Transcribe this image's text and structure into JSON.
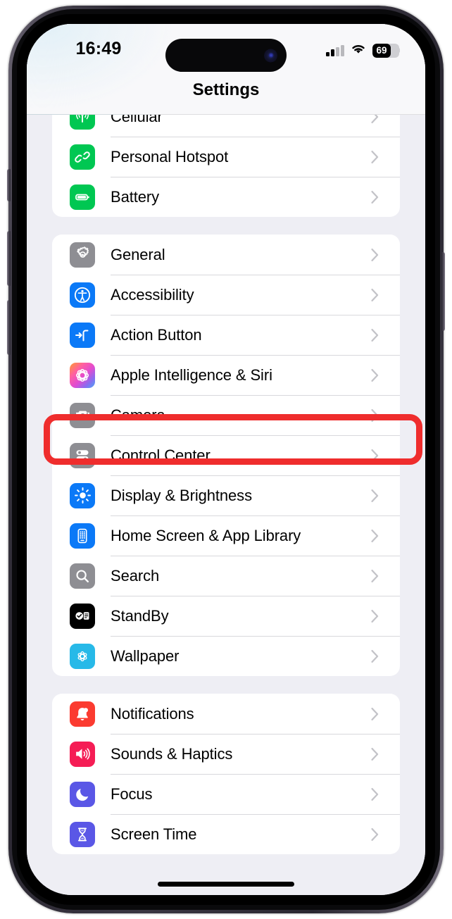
{
  "statusbar": {
    "time": "16:49",
    "battery_percent": "69",
    "battery_level": 69,
    "cellular_bars_filled": 2,
    "cellular_bars_total": 4,
    "wifi_icon": "wifi-icon",
    "battery_icon": "battery-icon"
  },
  "navbar": {
    "title": "Settings"
  },
  "highlight": {
    "target_row": "Camera",
    "color": "#ef2d2d"
  },
  "groups": [
    {
      "id": "connectivity",
      "rows": [
        {
          "label": "Cellular",
          "icon": "cellular-icon",
          "color": "#00c752"
        },
        {
          "label": "Personal Hotspot",
          "icon": "hotspot-icon",
          "color": "#00c752"
        },
        {
          "label": "Battery",
          "icon": "battery-settings-icon",
          "color": "#00c752"
        }
      ]
    },
    {
      "id": "system",
      "rows": [
        {
          "label": "General",
          "icon": "gear-icon",
          "color": "#8e8e93"
        },
        {
          "label": "Accessibility",
          "icon": "accessibility-icon",
          "color": "#0b79f7"
        },
        {
          "label": "Action Button",
          "icon": "action-button-icon",
          "color": "#0b79f7"
        },
        {
          "label": "Apple Intelligence & Siri",
          "icon": "apple-intelligence-icon",
          "color": "gradient"
        },
        {
          "label": "Camera",
          "icon": "camera-icon",
          "color": "#8e8e93"
        },
        {
          "label": "Control Center",
          "icon": "control-center-icon",
          "color": "#8e8e93"
        },
        {
          "label": "Display & Brightness",
          "icon": "brightness-icon",
          "color": "#0b79f7"
        },
        {
          "label": "Home Screen & App Library",
          "icon": "home-screen-icon",
          "color": "#0b79f7"
        },
        {
          "label": "Search",
          "icon": "search-icon",
          "color": "#8e8e93"
        },
        {
          "label": "StandBy",
          "icon": "standby-icon",
          "color": "#000000"
        },
        {
          "label": "Wallpaper",
          "icon": "wallpaper-icon",
          "color": "#27b9e8"
        }
      ]
    },
    {
      "id": "alerts",
      "rows": [
        {
          "label": "Notifications",
          "icon": "notifications-icon",
          "color": "#fb3b30"
        },
        {
          "label": "Sounds & Haptics",
          "icon": "sounds-icon",
          "color": "#f51d55"
        },
        {
          "label": "Focus",
          "icon": "focus-icon",
          "color": "#5a57e6"
        },
        {
          "label": "Screen Time",
          "icon": "screen-time-icon",
          "color": "#5a57e6"
        }
      ]
    }
  ]
}
